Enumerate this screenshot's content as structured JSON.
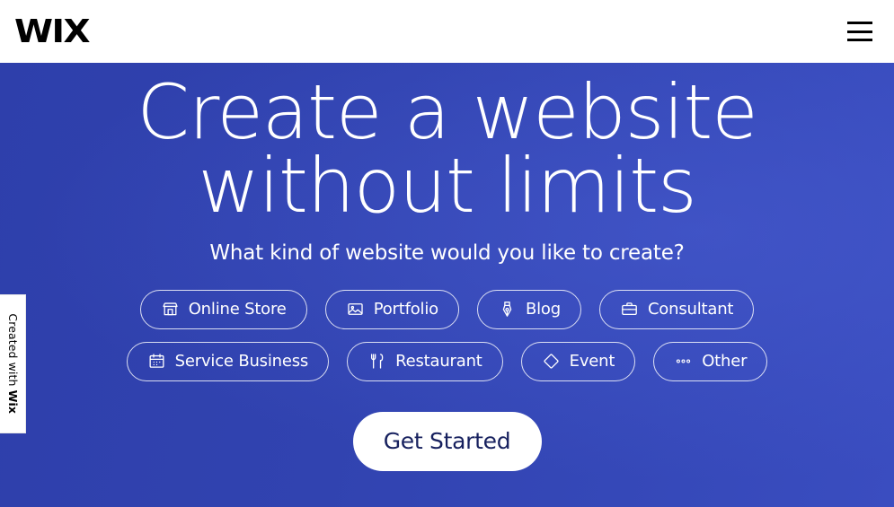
{
  "header": {
    "logo_text": "WIX",
    "menu_icon": "hamburger-menu-icon"
  },
  "hero": {
    "title": "Create a website\nwithout limits",
    "subtitle": "What kind of website would you like to create?",
    "cta_label": "Get Started",
    "background_color": "#3143b0",
    "text_color": "#ffffff"
  },
  "categories": {
    "row1": [
      {
        "label": "Online Store",
        "icon": "storefront-icon"
      },
      {
        "label": "Portfolio",
        "icon": "image-icon"
      },
      {
        "label": "Blog",
        "icon": "pen-nib-icon"
      },
      {
        "label": "Consultant",
        "icon": "briefcase-icon"
      }
    ],
    "row2": [
      {
        "label": "Service Business",
        "icon": "calendar-icon"
      },
      {
        "label": "Restaurant",
        "icon": "fork-knife-icon"
      },
      {
        "label": "Event",
        "icon": "ticket-icon"
      },
      {
        "label": "Other",
        "icon": "ellipsis-icon"
      }
    ]
  },
  "badge": {
    "prefix": "Created with ",
    "brand": "Wix"
  }
}
